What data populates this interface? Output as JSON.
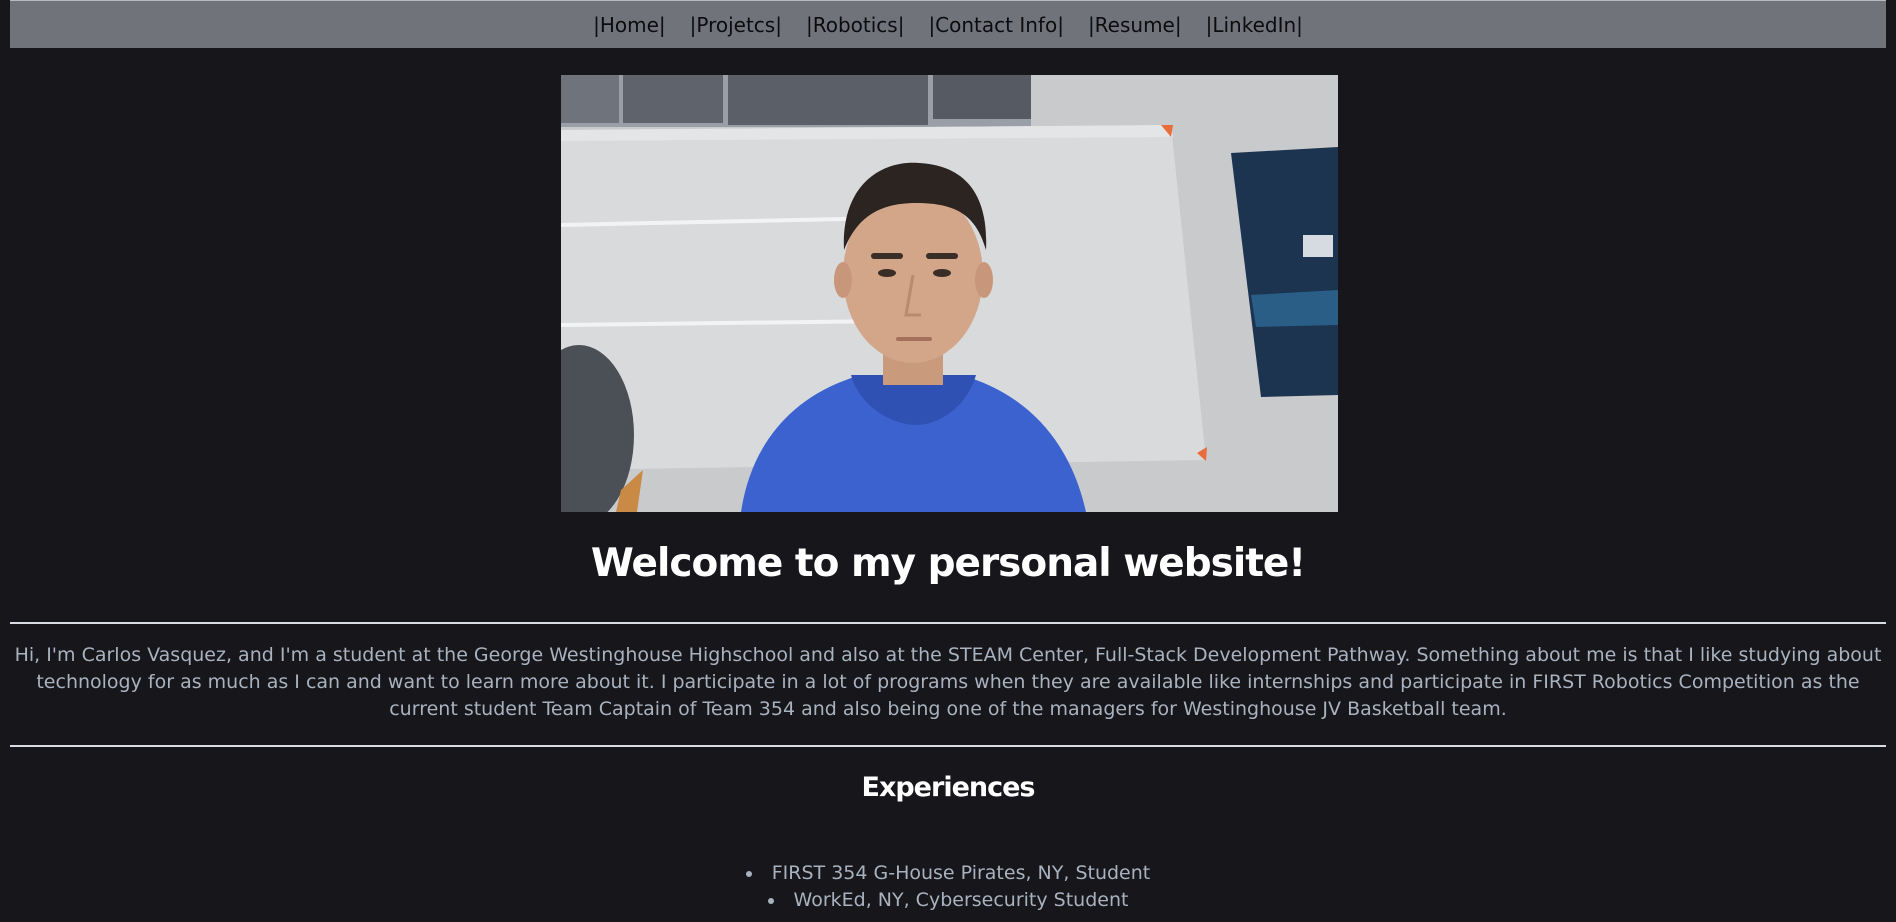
{
  "nav": {
    "items": [
      {
        "label": "|Home|"
      },
      {
        "label": "|Projetcs|"
      },
      {
        "label": "|Robotics|"
      },
      {
        "label": "|Contact Info|"
      },
      {
        "label": "|Resume|"
      },
      {
        "label": "|LinkedIn|"
      }
    ]
  },
  "hero": {
    "photo_alt": "Profile photo"
  },
  "main": {
    "title": "Welcome to my personal website!",
    "intro": "Hi, I'm Carlos Vasquez, and I'm a student at the George Westinghouse Highschool and also at the STEAM Center, Full-Stack Development Pathway. Something about me is that I like studying about technology for as much as I can and want to learn more about it. I participate in a lot of programs when they are available like internships and participate in FIRST Robotics Competition as the current student Team Captain of Team 354 and also being one of the managers for Westinghouse JV Basketball team."
  },
  "experiences": {
    "title": "Experiences",
    "items": [
      {
        "label": "FIRST 354 G-House Pirates, NY, Student"
      },
      {
        "label": "WorkEd, NY, Cybersecurity Student"
      }
    ]
  },
  "colors": {
    "background": "#16161b",
    "navbar": "#71737b",
    "heading": "#ffffff",
    "body_text": "#a9b2bf"
  }
}
